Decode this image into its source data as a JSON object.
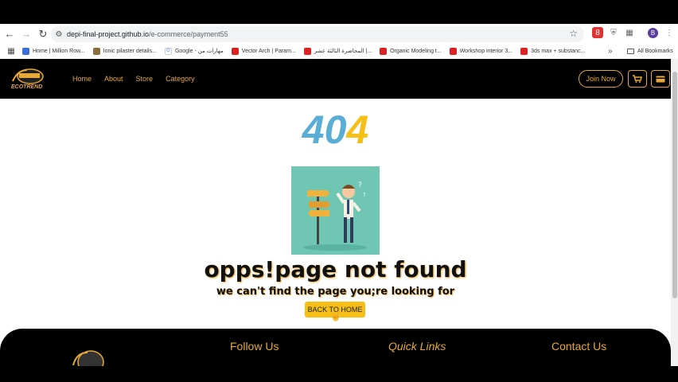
{
  "browser": {
    "url_host": "depi-final-project.github.io",
    "url_path": "/e-commerce/payment55",
    "profile_initial": "B",
    "ext_badge": "8",
    "bookmarks": [
      {
        "label": "Home | Million Row...",
        "icon": "site"
      },
      {
        "label": "Ionic pilaster details...",
        "icon": "site"
      },
      {
        "label": "Google - مهارات من",
        "icon": "google"
      },
      {
        "label": "Vector Arch | Param...",
        "icon": "youtube"
      },
      {
        "label": "المحاضرة الثالثة عشر |...",
        "icon": "youtube"
      },
      {
        "label": "Organic Modeling t...",
        "icon": "youtube"
      },
      {
        "label": "Workshop interior 3...",
        "icon": "youtube"
      },
      {
        "label": "3ds max + substanc...",
        "icon": "youtube"
      }
    ],
    "all_bookmarks": "All Bookmarks"
  },
  "site": {
    "logo_text": "ECOTREND",
    "nav": [
      "Home",
      "About",
      "Store",
      "Category"
    ],
    "join_label": "Join Now"
  },
  "error": {
    "digit1": "4",
    "digit2": "0",
    "digit3": "4",
    "title": "opps!page not found",
    "subtitle": "we can't find the page you;re looking for",
    "back_button": "BACK TO HOME"
  },
  "footer": {
    "follow": "Follow Us",
    "quick": "Quick Links",
    "contact": "Contact Us"
  },
  "colors": {
    "accent": "#e6a93a",
    "blue": "#5aaed6",
    "yellow": "#f5bf17",
    "illustration_bg": "#6fc7b3"
  }
}
